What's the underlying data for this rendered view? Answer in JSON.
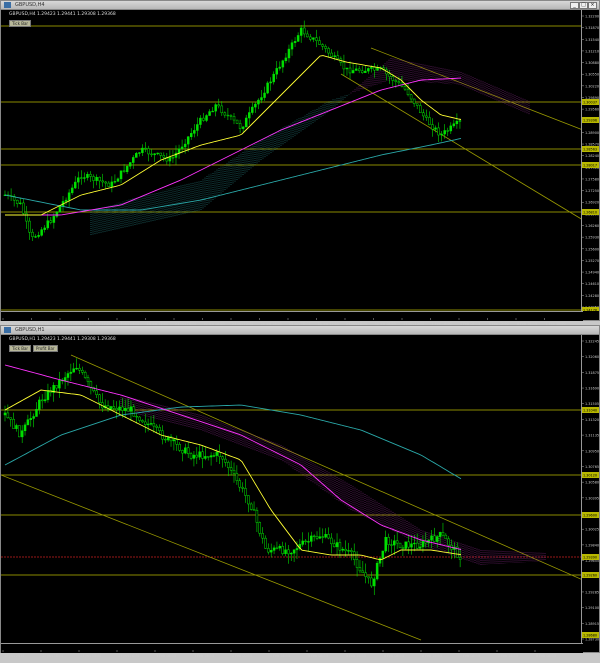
{
  "colors": {
    "background": "#000000",
    "candle": "#00e000",
    "ma_fast": "#ffff33",
    "ma_mid": "#ff33ff",
    "ma_slow": "#2aa8a8",
    "level": "#b8b800",
    "channel": "#9a9a00",
    "cloud_up": "#8a2a8a",
    "cloud_dn": "#2a8a8a",
    "bid": "#cc2222"
  },
  "top": {
    "title": "GBPUSD,H4",
    "info": "GBPUSD,H4  1.29423 1.29441 1.29308 1.29368",
    "tag": "Tick Bar",
    "icons": [
      "minimize-icon",
      "maximize-icon",
      "close-icon"
    ],
    "time_labels": [
      "11 Jan 2019",
      "14 Jan 16:00",
      "15 Jan 04:00",
      "16 Jan 12:00",
      "17 Jan 04:00",
      "18 Jan 12:00",
      "21 Jan 16:00",
      "22 Jan 08:00",
      "23 Jan 12:00",
      "24 Jan 16:00",
      "25 Jan 08:00",
      "28 Jan 12:00",
      "29 Jan 16:00",
      "30 Jan 08:00",
      "31 Jan 12:00",
      "1 Feb 16:00",
      "4 Feb 08:00",
      "5 Feb 12:00",
      "6 Feb 16:00",
      "7 Feb 08:00"
    ],
    "price_labels": [
      "1.32200",
      "1.31870",
      "1.31540",
      "1.31210",
      "1.30880",
      "1.30550",
      "1.30220",
      "1.29890",
      "1.29560",
      "1.29230",
      "1.28900",
      "1.28570",
      "1.28240",
      "1.27910",
      "1.27580",
      "1.27250",
      "1.26920",
      "1.26590",
      "1.26260",
      "1.25930",
      "1.25600",
      "1.25270",
      "1.24940",
      "1.24610",
      "1.24280",
      "1.23950"
    ],
    "level_tags": [
      "1.30037",
      "1.29396",
      "1.28563",
      "1.28017",
      "1.26810",
      "1.24178"
    ]
  },
  "bottom": {
    "title": "GBPUSD,H1",
    "info": "GBPUSD,H1  1.29423 1.29441 1.29308 1.29368",
    "tags": [
      "Tick Bar",
      "Profit Bar"
    ],
    "time_labels": [
      "30 Jan 2019",
      "30 Jan 08:00",
      "31 Jan 00:00",
      "31 Jan 16:00",
      "1 Feb 08:00",
      "1 Feb 16:00",
      "4 Feb 00:00",
      "4 Feb 16:00",
      "5 Feb 08:00",
      "5 Feb 16:00",
      "6 Feb 08:00",
      "6 Feb 16:00",
      "7 Feb 08:00",
      "7 Feb 16:00",
      "8 Feb 08:00"
    ],
    "price_labels": [
      "1.32245",
      "1.32060",
      "1.31875",
      "1.31690",
      "1.31505",
      "1.31320",
      "1.31135",
      "1.30950",
      "1.30765",
      "1.30580",
      "1.30395",
      "1.30210",
      "1.30025",
      "1.29840",
      "1.29655",
      "1.29470",
      "1.29285",
      "1.29100",
      "1.28915",
      "1.28730"
    ],
    "level_tags": [
      "1.31040",
      "1.30120",
      "1.29600",
      "1.29390",
      "1.29260",
      "1.28680"
    ]
  }
}
